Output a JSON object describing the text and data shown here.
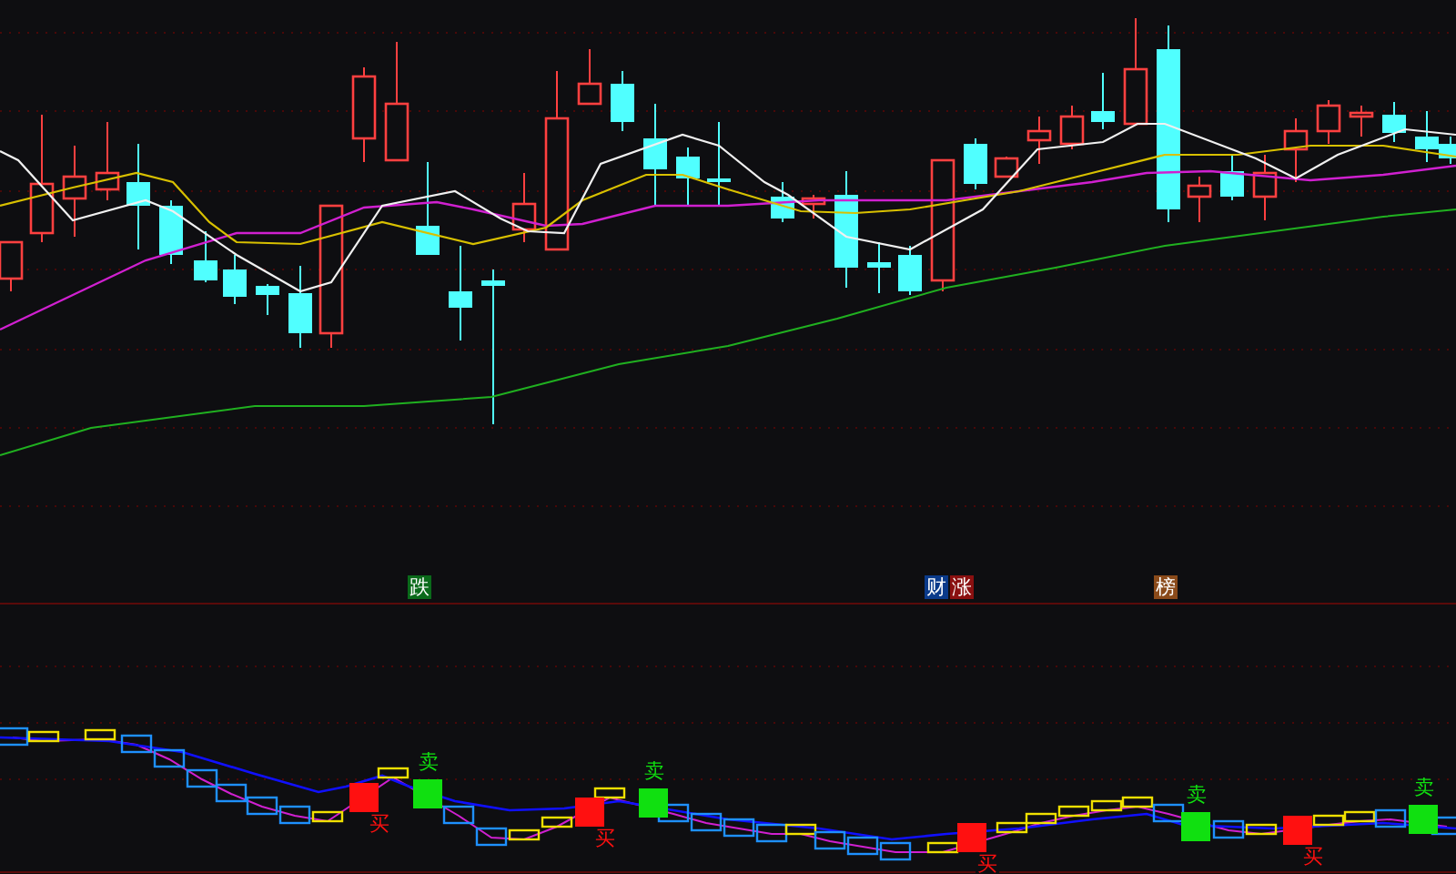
{
  "event_markers": [
    {
      "label": "跌",
      "color": "#0a6a1a"
    },
    {
      "label": "财",
      "color": "#0a3a8a"
    },
    {
      "label": "涨",
      "color": "#8a1010"
    },
    {
      "label": "榜",
      "color": "#8a4a1a"
    }
  ],
  "indicator_signals": [
    {
      "kind": "buy",
      "label": "买"
    },
    {
      "kind": "sell",
      "label": "卖"
    },
    {
      "kind": "buy",
      "label": "买"
    },
    {
      "kind": "sell",
      "label": "卖"
    },
    {
      "kind": "buy",
      "label": "买"
    },
    {
      "kind": "sell",
      "label": "卖"
    },
    {
      "kind": "buy",
      "label": "买"
    },
    {
      "kind": "sell",
      "label": "卖"
    }
  ]
}
